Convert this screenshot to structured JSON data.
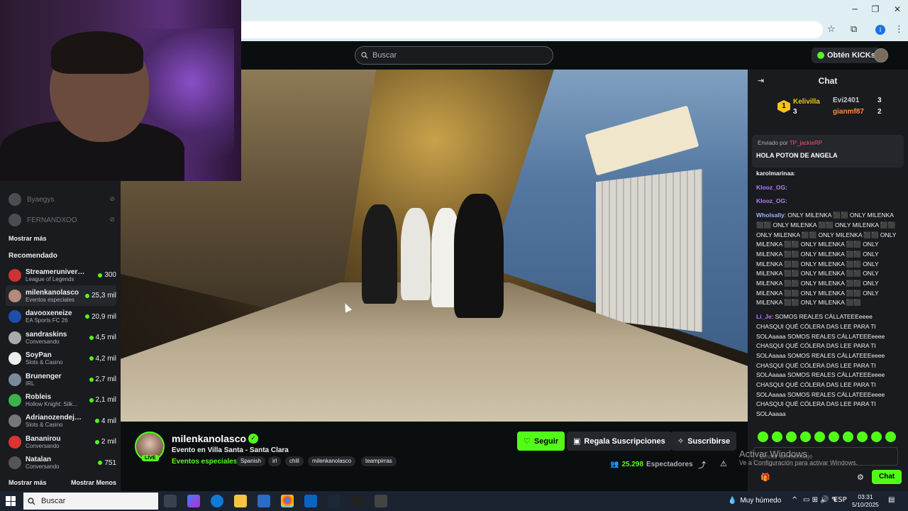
{
  "browser": {
    "minimize": "─",
    "maximize": "❐",
    "close": "✕",
    "star_icon": "☆",
    "extensions_icon": "⧉",
    "profile_initial": "I",
    "menu_icon": "⋮"
  },
  "header": {
    "search_placeholder": "Buscar",
    "kicks_label": "Obtén KICKs"
  },
  "sidebar": {
    "offline": [
      {
        "name": "Byaegys"
      },
      {
        "name": "FERNANDXOO"
      }
    ],
    "show_more_top": "Mostrar más",
    "recommended_heading": "Recomendado",
    "items": [
      {
        "name": "Streameruniversit...",
        "category": "League of Legends",
        "viewers": "300",
        "color": "#c33"
      },
      {
        "name": "milenkanolasco",
        "category": "Eventos especiales",
        "viewers": "25,3 mil",
        "color": "#b48a7a"
      },
      {
        "name": "davooxeneize",
        "category": "EA Sports FC 26",
        "viewers": "20,9 mil",
        "color": "#1d4fa8"
      },
      {
        "name": "sandraskins",
        "category": "Conversando",
        "viewers": "4,5 mil",
        "color": "#aaa"
      },
      {
        "name": "SoyPan",
        "category": "Slots & Casino",
        "viewers": "4,2 mil",
        "color": "#eee"
      },
      {
        "name": "Brunenger",
        "category": "IRL",
        "viewers": "2,7 mil",
        "color": "#7a8a9a"
      },
      {
        "name": "Robleis",
        "category": "Hollow Knight: Silk...",
        "viewers": "2,1 mil",
        "color": "#3bb34a"
      },
      {
        "name": "Adrianozendejas32",
        "category": "Slots & Casino",
        "viewers": "4 mil",
        "color": "#777"
      },
      {
        "name": "Bananirou",
        "category": "Conversando",
        "viewers": "2 mil",
        "color": "#d33"
      },
      {
        "name": "Natalan",
        "category": "Conversando",
        "viewers": "751",
        "color": "#555"
      }
    ],
    "show_more": "Mostrar más",
    "show_less": "Mostrar Menos"
  },
  "stream": {
    "streamer": "milenkanolasco",
    "live_badge": "LIVE",
    "title": "Evento en Villa Santa - Santa Clara",
    "category": "Eventos especiales",
    "tags": [
      "Spanish",
      "irl",
      "chill",
      "milenkanolasco",
      "teampirras"
    ],
    "follow_label": "Seguir",
    "gift_label": "Regala Suscripciones",
    "subscribe_label": "Suscribirse",
    "viewers_count": "25.298",
    "viewers_label": "Espectadores",
    "share_icon": "⤴",
    "report_icon": "⚠",
    "verified_icon": "✓"
  },
  "chat": {
    "title": "Chat",
    "collapse_icon": "⇥",
    "leaderboard": [
      {
        "name": "Kelivilla",
        "amount": "3",
        "rank": "1"
      },
      {
        "name": "Evi2401",
        "amount": "3"
      },
      {
        "name": "gianmf87",
        "amount": "2"
      }
    ],
    "pinned_prefix": "Enviado por",
    "pinned_user": "TP_jackieRP",
    "pinned_message": "HOLA POTON DE ANGELA",
    "messages": [
      {
        "user": "karolmarinaa",
        "color": "#efeff1",
        "text": ""
      },
      {
        "user": "Klooz_OG",
        "color": "#b47cff",
        "text": ""
      },
      {
        "user": "Klooz_OG",
        "color": "#b47cff",
        "text": ""
      },
      {
        "user": "Wholsally",
        "color": "#9ab4ff",
        "text": "ONLY MILENKA ⬛⬛ ONLY MILENKA ⬛⬛ ONLY MILENKA ⬛⬛ ONLY MILENKA ⬛⬛ ONLY MILENKA ⬛⬛ ONLY MILENKA ⬛⬛ ONLY MILENKA ⬛⬛ ONLY MILENKA ⬛⬛ ONLY MILENKA ⬛⬛ ONLY MILENKA ⬛⬛ ONLY MILENKA ⬛⬛ ONLY MILENKA ⬛⬛ ONLY MILENKA ⬛⬛ ONLY MILENKA ⬛⬛ ONLY MILENKA ⬛⬛ ONLY MILENKA ⬛⬛ ONLY MILENKA ⬛⬛ ONLY MILENKA ⬛⬛ ONLY MILENKA ⬛⬛ ONLY MILENKA ⬛⬛"
      },
      {
        "user": "Li_Je",
        "color": "#b47cff",
        "text": "SOMOS REALES CÁLLATEEEeeee CHASQUI QUÉ CÓLERA DAS LEE PARA TI SOLAaaaa SOMOS REALES CÁLLATEEEeeee CHASQUI QUÉ CÓLERA DAS LEE PARA TI SOLAaaaa SOMOS REALES CÁLLATEEEeeee CHASQUI QUÉ CÓLERA DAS LEE PARA TI SOLAaaaa SOMOS REALES CÁLLATEEEeeee CHASQUI QUÉ CÓLERA DAS LEE PARA TI SOLAaaaa SOMOS REALES CÁLLATEEEeeee CHASQUI QUÉ CÓLERA DAS LEE PARA TI SOLAaaaa"
      }
    ],
    "input_placeholder": "Enviar un mensaje",
    "send_label": "Chat",
    "gear_icon": "⚙",
    "gift_icon": "🎁"
  },
  "watermark": {
    "line1": "Activar Windows",
    "line2": "Ve a Configuración para activar Windows."
  },
  "taskbar": {
    "search_label": "Buscar",
    "weather": "Muy húmedo",
    "language": "ESP",
    "time": "03:31",
    "date": "5/10/2025"
  }
}
